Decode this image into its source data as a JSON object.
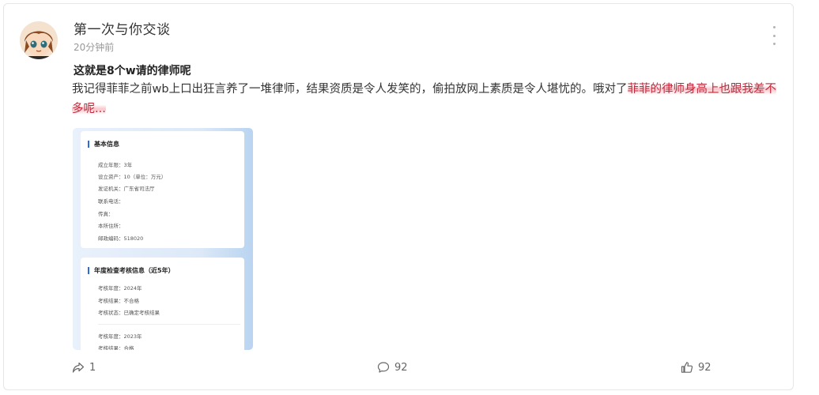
{
  "post": {
    "username": "第一次与你交谈",
    "time": "20分钟前",
    "title": "这就是8个w请的律师呢",
    "body_plain": "我记得菲菲之前wb上口出狂言养了一堆律师，结果资质是令人发笑的，偷拍放网上素质是令人堪忧的。哦对了",
    "body_highlight": "菲菲的律师身高上也跟我差不多呢...",
    "highlight_color": "#f5a0aa"
  },
  "image": {
    "section1": {
      "title": "基本信息",
      "rows": [
        "成立年限：3年",
        "设立资产：10（单位：万元）",
        "发证机关：广东省司法厅",
        "联系电话：",
        "传真：",
        "本所住所：",
        "邮政编码：518020"
      ]
    },
    "section2": {
      "title": "年度检查考核信息（近5年）",
      "rows_a": [
        "考核年度：2024年",
        "考核结果：不合格",
        "考核状态：已确定考核结果"
      ],
      "rows_b": [
        "考核年度：2023年",
        "考核结果：合格"
      ]
    }
  },
  "actions": {
    "share_count": "1",
    "comment_count": "92",
    "like_count": "92"
  },
  "icons": [
    "more-icon",
    "share-icon",
    "comment-icon",
    "like-icon"
  ]
}
